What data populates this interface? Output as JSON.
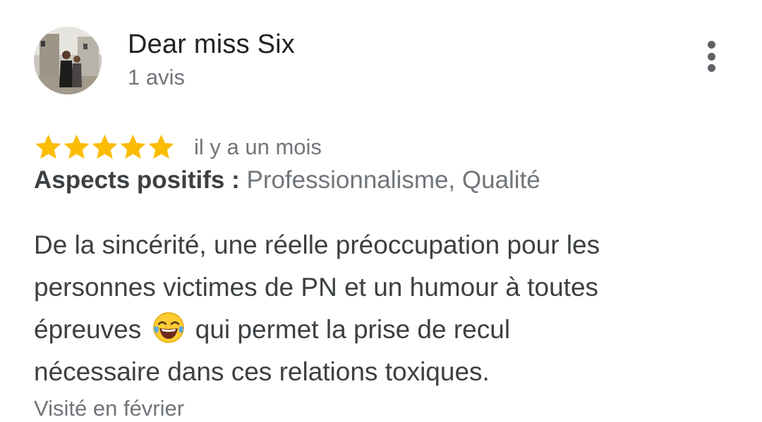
{
  "author": {
    "name": "Dear miss Six",
    "reviews_count": "1 avis",
    "avatar": "user-photo"
  },
  "menu": {
    "icon": "more-vertical-icon"
  },
  "rating": {
    "stars": 5,
    "max": 5,
    "color": "#fbbc04",
    "time_ago": "il y a un mois"
  },
  "aspects": {
    "label": "Aspects positifs :",
    "value": "Professionnalisme, Qualité"
  },
  "review": {
    "line1": "De la sincérité, une réelle préoccupation pour les",
    "line2": "personnes victimes de PN et un humour à toutes",
    "line3_before": "épreuves",
    "emoji": "tears-of-joy-emoji",
    "line3_after": "qui permet la prise de recul",
    "line4": "nécessaire dans ces relations toxiques."
  },
  "visited": "Visité en février"
}
